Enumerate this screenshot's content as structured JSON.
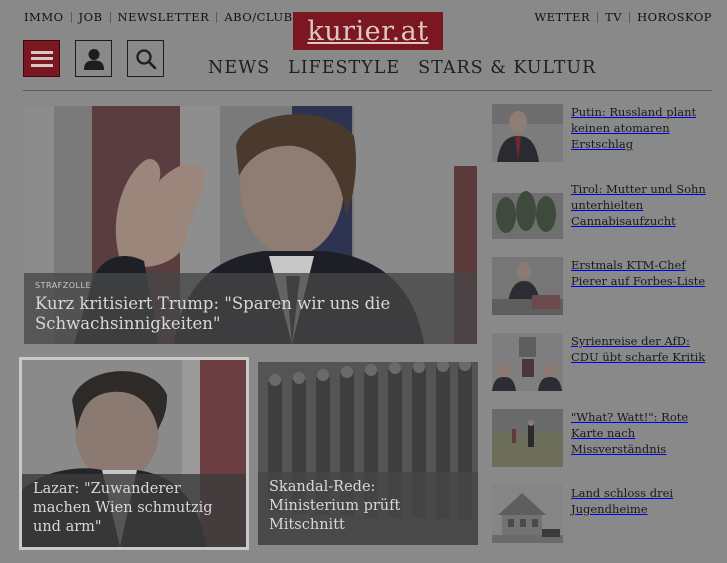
{
  "top_left_links": [
    "IMMO",
    "JOB",
    "NEWSLETTER",
    "ABO/CLUB"
  ],
  "top_right_links": [
    "WETTER",
    "TV",
    "HOROSKOP"
  ],
  "logo": "kurier.at",
  "main_nav": [
    "NEWS",
    "LIFESTYLE",
    "STARS & KULTUR"
  ],
  "icons": {
    "menu": "hamburger-menu-icon",
    "user": "user-icon",
    "search": "search-icon"
  },
  "colors": {
    "brand": "#7a1720",
    "overlay": "#898989"
  },
  "hero": {
    "kicker": "STRAFZOLLE",
    "title": "Kurz kritisiert Trump: \"Sparen wir uns die Schwachsinnigkeiten\""
  },
  "bottom_tiles": [
    {
      "title": "Lazar: \"Zuwanderer machen Wien schmutzig und arm\""
    },
    {
      "title": "Skandal-Rede: Ministerium prüft Mitschnitt"
    }
  ],
  "side_articles": [
    {
      "title": "Putin: Russland plant keinen atomaren Erstschlag"
    },
    {
      "title": "Tirol: Mutter und Sohn unterhielten Cannabisaufzucht"
    },
    {
      "title": "Erstmals KTM-Chef Pierer auf Forbes-Liste"
    },
    {
      "title": "Syrienreise der AfD: CDU übt scharfe Kritik"
    },
    {
      "title": "\"What? Watt!\": Rote Karte nach Missverständnis"
    },
    {
      "title": "Land schloss drei Jugendheime"
    }
  ]
}
